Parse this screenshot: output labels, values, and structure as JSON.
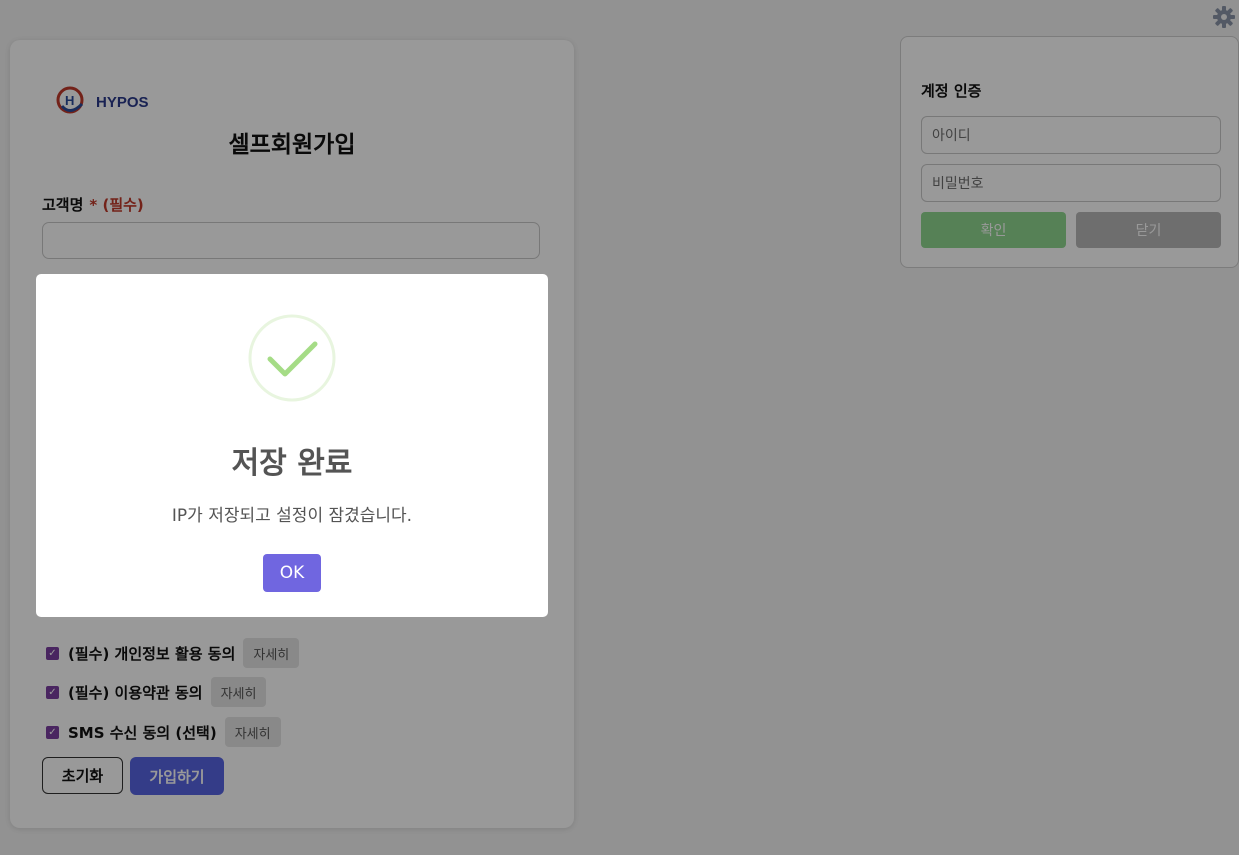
{
  "signup": {
    "logo_text": "HYPOS",
    "title": "셀프회원가입",
    "name_label": "고객명",
    "name_required": "* (필수)",
    "consents": [
      {
        "label": "(필수) 개인정보 활용 동의",
        "detail": "자세히"
      },
      {
        "label": "(필수) 이용약관 동의",
        "detail": "자세히"
      },
      {
        "label": "SMS 수신 동의 (선택)",
        "detail": "자세히"
      }
    ],
    "reset_label": "초기화",
    "join_label": "가입하기"
  },
  "auth": {
    "title": "계정 인증",
    "id_placeholder": "아이디",
    "password_placeholder": "비밀번호",
    "confirm_label": "확인",
    "close_label": "닫기"
  },
  "modal": {
    "title": "저장 완료",
    "message": "IP가 저장되고 설정이 잠겼습니다.",
    "ok_label": "OK"
  },
  "icons": {
    "settings": "gear-icon",
    "success": "checkmark-circle-icon",
    "checkbox": "checkbox-checked-icon"
  },
  "colors": {
    "join_button": "#5864e3",
    "confirm_button": "#8fd88f",
    "close_button": "#b8b8b8",
    "ok_button": "#7066e0",
    "success_check": "#a5dc86",
    "required": "#c0392b",
    "checkbox": "#7b3fa0"
  }
}
